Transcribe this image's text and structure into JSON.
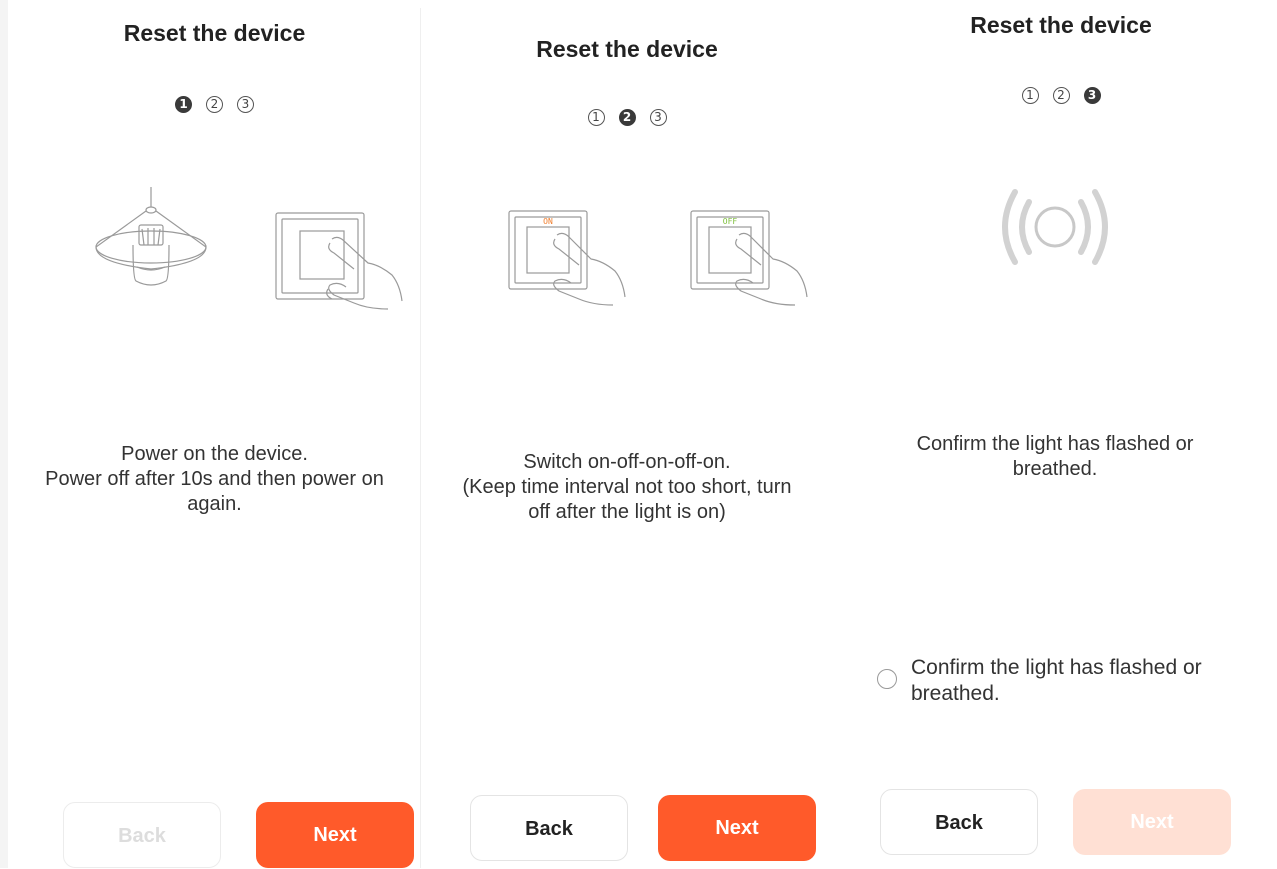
{
  "panels": [
    {
      "title": "Reset the device",
      "steps": [
        "1",
        "2",
        "3"
      ],
      "active_step": 1,
      "illustration": [
        "pendant-lamp-icon",
        "wall-switch-press-icon"
      ],
      "description": [
        "Power on the device.",
        "Power off after 10s and then power on",
        "again."
      ],
      "back_label": "Back",
      "next_label": "Next",
      "back_enabled": false,
      "next_enabled": true
    },
    {
      "title": "Reset the device",
      "steps": [
        "1",
        "2",
        "3"
      ],
      "active_step": 2,
      "illustration": [
        "switch-on-icon",
        "switch-off-icon"
      ],
      "switch_on_label": "ON",
      "switch_off_label": "OFF",
      "description": [
        "Switch on-off-on-off-on.",
        "(Keep time interval not too short, turn",
        "off after the light is on)"
      ],
      "back_label": "Back",
      "next_label": "Next",
      "back_enabled": true,
      "next_enabled": true
    },
    {
      "title": "Reset the device",
      "steps": [
        "1",
        "2",
        "3"
      ],
      "active_step": 3,
      "illustration": [
        "light-flashing-icon"
      ],
      "description": [
        "Confirm the light has flashed or",
        "breathed."
      ],
      "confirm_label": [
        "Confirm the light has flashed or",
        "breathed."
      ],
      "confirm_checked": false,
      "back_label": "Back",
      "next_label": "Next",
      "back_enabled": true,
      "next_enabled": false
    }
  ],
  "colors": {
    "accent": "#ff5a2a",
    "accent_disabled": "#ffe0d4",
    "switch_on": "#f07c2a",
    "switch_off": "#7cbf3a"
  }
}
